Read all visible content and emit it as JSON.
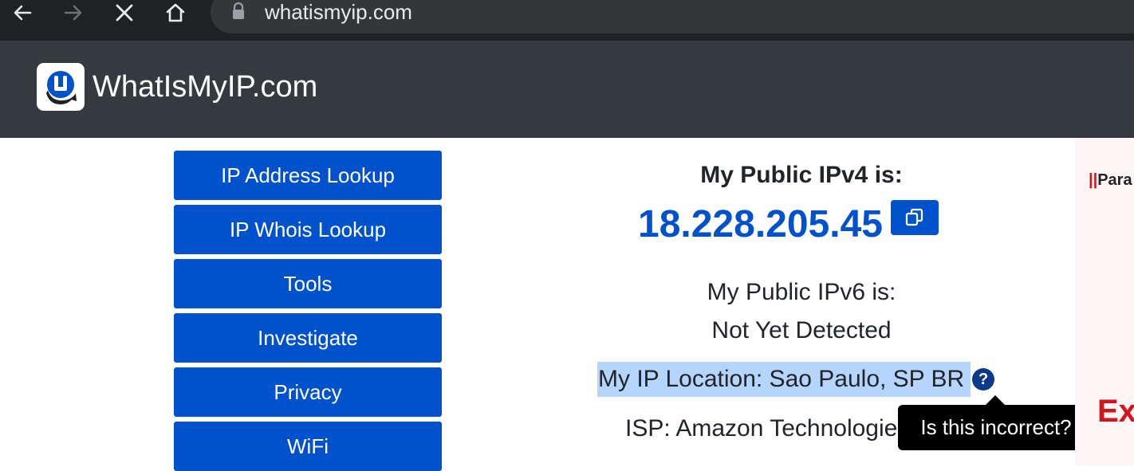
{
  "browser": {
    "url": "whatismyip.com"
  },
  "site": {
    "title": "WhatIsMyIP.com"
  },
  "sidebar": {
    "items": [
      {
        "label": "IP Address Lookup"
      },
      {
        "label": "IP Whois Lookup"
      },
      {
        "label": "Tools"
      },
      {
        "label": "Investigate"
      },
      {
        "label": "Privacy"
      },
      {
        "label": "WiFi"
      }
    ]
  },
  "main": {
    "ipv4_label": "My Public IPv4 is:",
    "ipv4_value": "18.228.205.45",
    "ipv6_label": "My Public IPv6 is:",
    "ipv6_value": "Not Yet Detected",
    "location_text": "My IP Location: Sao Paulo, SP BR",
    "help_glyph": "?",
    "isp_text": "ISP: Amazon Technologies Inc.",
    "tooltip_text": "Is this incorrect?"
  },
  "ad": {
    "brand_bars": "||",
    "brand_text": "Para",
    "headline": "Ex"
  },
  "colors": {
    "accent_blue": "#0052cc",
    "header_bg": "#343a40",
    "chrome_bg": "#202124",
    "selection_bg": "#b4d5fe",
    "ad_red": "#d2151d"
  },
  "icons": [
    "back-arrow-icon",
    "forward-arrow-icon",
    "stop-loading-icon",
    "home-icon",
    "lock-icon",
    "logo-icon",
    "copy-icon",
    "question-circle-icon"
  ]
}
